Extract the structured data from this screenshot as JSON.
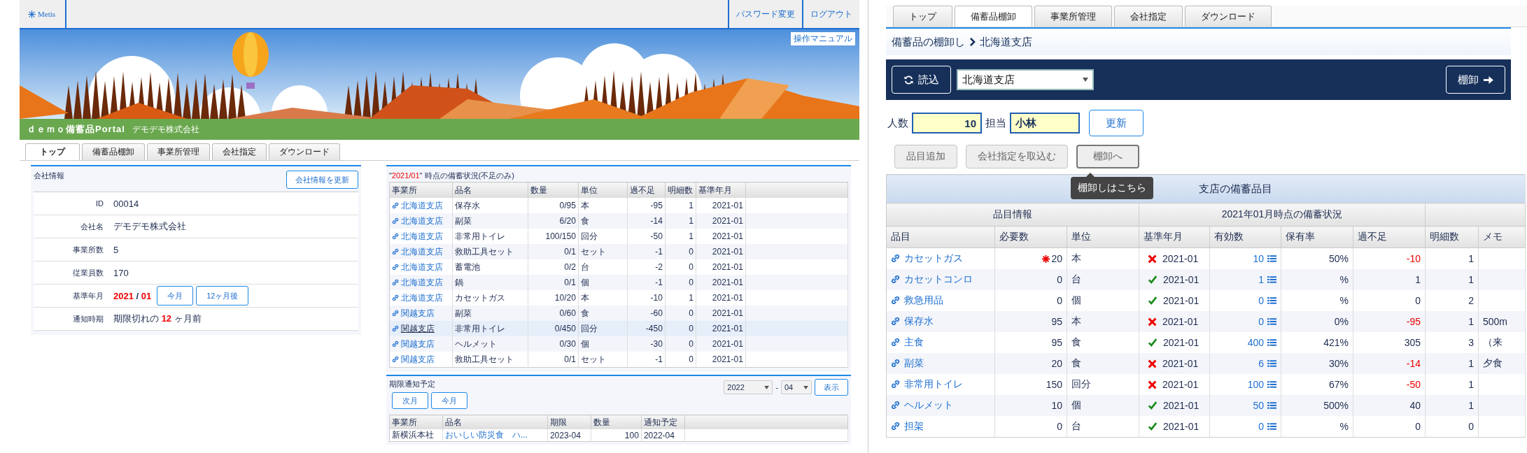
{
  "left": {
    "topbar": {
      "logo": "Metis",
      "links": [
        "パスワード変更",
        "ログアウト"
      ]
    },
    "banner": {
      "manual_link": "操作マニュアル",
      "portal_title": "ｄｅｍｏ備蓄品Portal",
      "company": "デモデモ株式会社"
    },
    "tabs": [
      {
        "label": "トップ",
        "selected": true
      },
      {
        "label": "備蓄品棚卸",
        "selected": false
      },
      {
        "label": "事業所管理",
        "selected": false
      },
      {
        "label": "会社指定",
        "selected": false
      },
      {
        "label": "ダウンロード",
        "selected": false
      }
    ],
    "company_info": {
      "title": "会社情報",
      "update_button": "会社情報を更新",
      "rows": [
        {
          "kind": "text",
          "label": "ID",
          "value": "00014"
        },
        {
          "kind": "text",
          "label": "会社名",
          "value": "デモデモ株式会社"
        },
        {
          "kind": "text",
          "label": "事業所数",
          "value": "5"
        },
        {
          "kind": "text",
          "label": "従業員数",
          "value": "170"
        },
        {
          "kind": "month",
          "label": "基準年月",
          "year": "2021",
          "separator": "/",
          "month": "01",
          "buttons": [
            "今月",
            "12ヶ月後"
          ]
        },
        {
          "kind": "notice",
          "label": "通知時期",
          "prefix": "期限切れの",
          "value": "12",
          "suffix": "ヶ月前"
        }
      ]
    },
    "stock_status": {
      "title_open": "\"",
      "period": "2021/01",
      "title_rest": "\" 時点の備蓄状況(不足のみ)",
      "columns": [
        "事業所",
        "品名",
        "数量",
        "単位",
        "過不足",
        "明細数",
        "基準年月"
      ],
      "rows": [
        {
          "office": "北海道支店",
          "item": "保存水",
          "quantity": "0/95",
          "unit": "本",
          "balance": "-95",
          "details": "1",
          "month": "2021-01",
          "selected": false
        },
        {
          "office": "北海道支店",
          "item": "副菜",
          "quantity": "6/20",
          "unit": "食",
          "balance": "-14",
          "details": "1",
          "month": "2021-01",
          "selected": false
        },
        {
          "office": "北海道支店",
          "item": "非常用トイレ",
          "quantity": "100/150",
          "unit": "回分",
          "balance": "-50",
          "details": "1",
          "month": "2021-01",
          "selected": false
        },
        {
          "office": "北海道支店",
          "item": "救助工具セット",
          "quantity": "0/1",
          "unit": "セット",
          "balance": "-1",
          "details": "0",
          "month": "2021-01",
          "selected": false
        },
        {
          "office": "北海道支店",
          "item": "蓄電池",
          "quantity": "0/2",
          "unit": "台",
          "balance": "-2",
          "details": "0",
          "month": "2021-01",
          "selected": false
        },
        {
          "office": "北海道支店",
          "item": "鍋",
          "quantity": "0/1",
          "unit": "個",
          "balance": "-1",
          "details": "0",
          "month": "2021-01",
          "selected": false
        },
        {
          "office": "北海道支店",
          "item": "カセットガス",
          "quantity": "10/20",
          "unit": "本",
          "balance": "-10",
          "details": "1",
          "month": "2021-01",
          "selected": false
        },
        {
          "office": "関越支店",
          "item": "副菜",
          "quantity": "0/60",
          "unit": "食",
          "balance": "-60",
          "details": "0",
          "month": "2021-01",
          "selected": false
        },
        {
          "office": "関越支店",
          "item": "非常用トイレ",
          "quantity": "0/450",
          "unit": "回分",
          "balance": "-450",
          "details": "0",
          "month": "2021-01",
          "selected": true
        },
        {
          "office": "関越支店",
          "item": "ヘルメット",
          "quantity": "0/30",
          "unit": "個",
          "balance": "-30",
          "details": "0",
          "month": "2021-01",
          "selected": false
        },
        {
          "office": "関越支店",
          "item": "救助工具セット",
          "quantity": "0/1",
          "unit": "セット",
          "balance": "-1",
          "details": "0",
          "month": "2021-01",
          "selected": false
        }
      ]
    },
    "expiry": {
      "title": "期限通知予定",
      "buttons": [
        "次月",
        "今月"
      ],
      "year": "2022",
      "separator": "-",
      "month": "04",
      "show_button": "表示",
      "columns": [
        "事業所",
        "品名",
        "期限",
        "数量",
        "通知予定"
      ],
      "rows": [
        {
          "office": "新横浜本社",
          "item": "おいしい防災食　ハ...",
          "deadline": "2023-04",
          "quantity": "100",
          "notify": "2022-04"
        }
      ]
    }
  },
  "right": {
    "tabs": [
      {
        "label": "トップ",
        "selected": false
      },
      {
        "label": "備蓄品棚卸",
        "selected": true
      },
      {
        "label": "事業所管理",
        "selected": false
      },
      {
        "label": "会社指定",
        "selected": false
      },
      {
        "label": "ダウンロード",
        "selected": false
      }
    ],
    "breadcrumb": {
      "parent": "備蓄品の棚卸し",
      "current": "北海道支店"
    },
    "toolbar": {
      "load_button": "読込",
      "office_select": "北海道支店",
      "inventory_button": "棚卸"
    },
    "form": {
      "people_label": "人数",
      "people": "10",
      "staff_label": "担当",
      "staff": "小林",
      "update_button": "更新"
    },
    "actions": [
      {
        "label": "品目追加",
        "focused": false
      },
      {
        "label": "会社指定を取込む",
        "focused": false
      },
      {
        "label": "棚卸へ",
        "focused": true,
        "tooltip": "棚卸しはこちら"
      }
    ],
    "table": {
      "title": "支店の備蓄品目",
      "groups": [
        "品目情報",
        "2021年01月時点の備蓄状況"
      ],
      "columns": [
        "品目",
        "必要数",
        "単位",
        "基準年月",
        "有効数",
        "保有率",
        "過不足",
        "明細数",
        "メモ"
      ],
      "rows": [
        {
          "item": "カセットガス",
          "required": "20",
          "required_mark": true,
          "unit": "本",
          "ok": false,
          "month": "2021-01",
          "effective": "10",
          "rate": "50%",
          "balance": "-10",
          "shortage": true,
          "details": "1"
        },
        {
          "item": "カセットコンロ",
          "required": "0",
          "required_mark": false,
          "unit": "台",
          "ok": true,
          "month": "2021-01",
          "effective": "1",
          "rate": "%",
          "balance": "1",
          "shortage": false,
          "details": "1"
        },
        {
          "item": "救急用品",
          "required": "0",
          "required_mark": false,
          "unit": "個",
          "ok": true,
          "month": "2021-01",
          "effective": "0",
          "rate": "%",
          "balance": "0",
          "shortage": false,
          "details": "2"
        },
        {
          "item": "保存水",
          "required": "95",
          "required_mark": false,
          "unit": "本",
          "ok": false,
          "month": "2021-01",
          "effective": "0",
          "rate": "0%",
          "balance": "-95",
          "shortage": true,
          "details": "1",
          "memo": "500m"
        },
        {
          "item": "主食",
          "required": "95",
          "required_mark": false,
          "unit": "食",
          "ok": true,
          "month": "2021-01",
          "effective": "400",
          "rate": "421%",
          "balance": "305",
          "shortage": false,
          "details": "3",
          "memo": "（来"
        },
        {
          "item": "副菜",
          "required": "20",
          "required_mark": false,
          "unit": "食",
          "ok": false,
          "month": "2021-01",
          "effective": "6",
          "rate": "30%",
          "balance": "-14",
          "shortage": true,
          "details": "1",
          "memo": "夕食"
        },
        {
          "item": "非常用トイレ",
          "required": "150",
          "required_mark": false,
          "unit": "回分",
          "ok": false,
          "month": "2021-01",
          "effective": "100",
          "rate": "67%",
          "balance": "-50",
          "shortage": true,
          "details": "1"
        },
        {
          "item": "ヘルメット",
          "required": "10",
          "required_mark": false,
          "unit": "個",
          "ok": true,
          "month": "2021-01",
          "effective": "50",
          "rate": "500%",
          "balance": "40",
          "shortage": false,
          "details": "1"
        },
        {
          "item": "担架",
          "required": "0",
          "required_mark": false,
          "unit": "台",
          "ok": true,
          "month": "2021-01",
          "effective": "0",
          "rate": "%",
          "balance": "0",
          "shortage": false,
          "details": "0"
        }
      ]
    }
  }
}
